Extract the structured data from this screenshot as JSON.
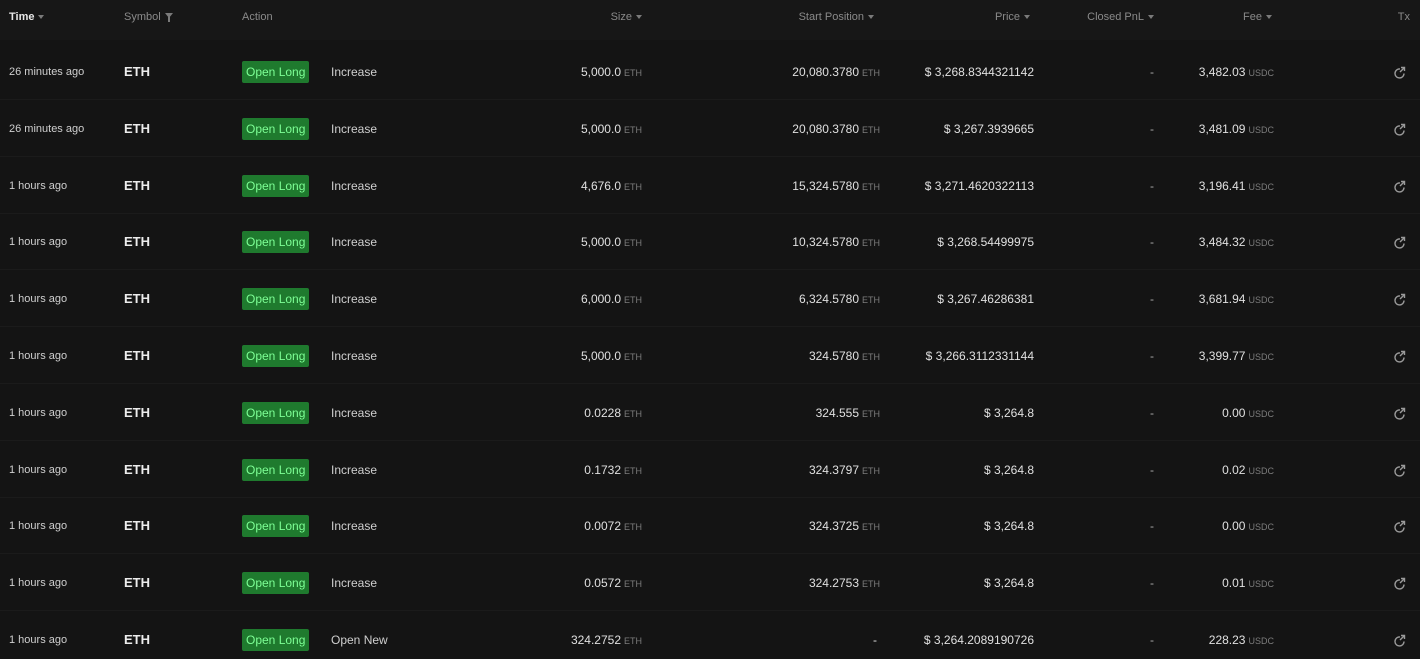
{
  "header": {
    "time": "Time",
    "symbol": "Symbol",
    "action": "Action",
    "size": "Size",
    "start_position": "Start Position",
    "price": "Price",
    "closed_pnl": "Closed PnL",
    "fee": "Fee",
    "tx": "Tx"
  },
  "colors": {
    "background": "#141414",
    "badge_bg": "#1f7a2e",
    "badge_text": "#7dff95"
  },
  "rows": [
    {
      "time": "26 minutes ago",
      "symbol": "ETH",
      "action": "Open Long",
      "detail": "Increase",
      "size": "5,000.0",
      "size_unit": "ETH",
      "start": "20,080.3780",
      "start_unit": "ETH",
      "price": "$ 3,268.8344321142",
      "pnl": "-",
      "fee": "3,482.03",
      "fee_unit": "USDC"
    },
    {
      "time": "26 minutes ago",
      "symbol": "ETH",
      "action": "Open Long",
      "detail": "Increase",
      "size": "5,000.0",
      "size_unit": "ETH",
      "start": "20,080.3780",
      "start_unit": "ETH",
      "price": "$ 3,267.3939665",
      "pnl": "-",
      "fee": "3,481.09",
      "fee_unit": "USDC"
    },
    {
      "time": "1 hours ago",
      "symbol": "ETH",
      "action": "Open Long",
      "detail": "Increase",
      "size": "4,676.0",
      "size_unit": "ETH",
      "start": "15,324.5780",
      "start_unit": "ETH",
      "price": "$ 3,271.4620322113",
      "pnl": "-",
      "fee": "3,196.41",
      "fee_unit": "USDC"
    },
    {
      "time": "1 hours ago",
      "symbol": "ETH",
      "action": "Open Long",
      "detail": "Increase",
      "size": "5,000.0",
      "size_unit": "ETH",
      "start": "10,324.5780",
      "start_unit": "ETH",
      "price": "$ 3,268.54499975",
      "pnl": "-",
      "fee": "3,484.32",
      "fee_unit": "USDC"
    },
    {
      "time": "1 hours ago",
      "symbol": "ETH",
      "action": "Open Long",
      "detail": "Increase",
      "size": "6,000.0",
      "size_unit": "ETH",
      "start": "6,324.5780",
      "start_unit": "ETH",
      "price": "$ 3,267.46286381",
      "pnl": "-",
      "fee": "3,681.94",
      "fee_unit": "USDC"
    },
    {
      "time": "1 hours ago",
      "symbol": "ETH",
      "action": "Open Long",
      "detail": "Increase",
      "size": "5,000.0",
      "size_unit": "ETH",
      "start": "324.5780",
      "start_unit": "ETH",
      "price": "$ 3,266.3112331144",
      "pnl": "-",
      "fee": "3,399.77",
      "fee_unit": "USDC"
    },
    {
      "time": "1 hours ago",
      "symbol": "ETH",
      "action": "Open Long",
      "detail": "Increase",
      "size": "0.0228",
      "size_unit": "ETH",
      "start": "324.555",
      "start_unit": "ETH",
      "price": "$ 3,264.8",
      "pnl": "-",
      "fee": "0.00",
      "fee_unit": "USDC"
    },
    {
      "time": "1 hours ago",
      "symbol": "ETH",
      "action": "Open Long",
      "detail": "Increase",
      "size": "0.1732",
      "size_unit": "ETH",
      "start": "324.3797",
      "start_unit": "ETH",
      "price": "$ 3,264.8",
      "pnl": "-",
      "fee": "0.02",
      "fee_unit": "USDC"
    },
    {
      "time": "1 hours ago",
      "symbol": "ETH",
      "action": "Open Long",
      "detail": "Increase",
      "size": "0.0072",
      "size_unit": "ETH",
      "start": "324.3725",
      "start_unit": "ETH",
      "price": "$ 3,264.8",
      "pnl": "-",
      "fee": "0.00",
      "fee_unit": "USDC"
    },
    {
      "time": "1 hours ago",
      "symbol": "ETH",
      "action": "Open Long",
      "detail": "Increase",
      "size": "0.0572",
      "size_unit": "ETH",
      "start": "324.2753",
      "start_unit": "ETH",
      "price": "$ 3,264.8",
      "pnl": "-",
      "fee": "0.01",
      "fee_unit": "USDC"
    },
    {
      "time": "1 hours ago",
      "symbol": "ETH",
      "action": "Open Long",
      "detail": "Open New",
      "size": "324.2752",
      "size_unit": "ETH",
      "start": "-",
      "start_unit": "",
      "price": "$ 3,264.2089190726",
      "pnl": "-",
      "fee": "228.23",
      "fee_unit": "USDC"
    }
  ]
}
